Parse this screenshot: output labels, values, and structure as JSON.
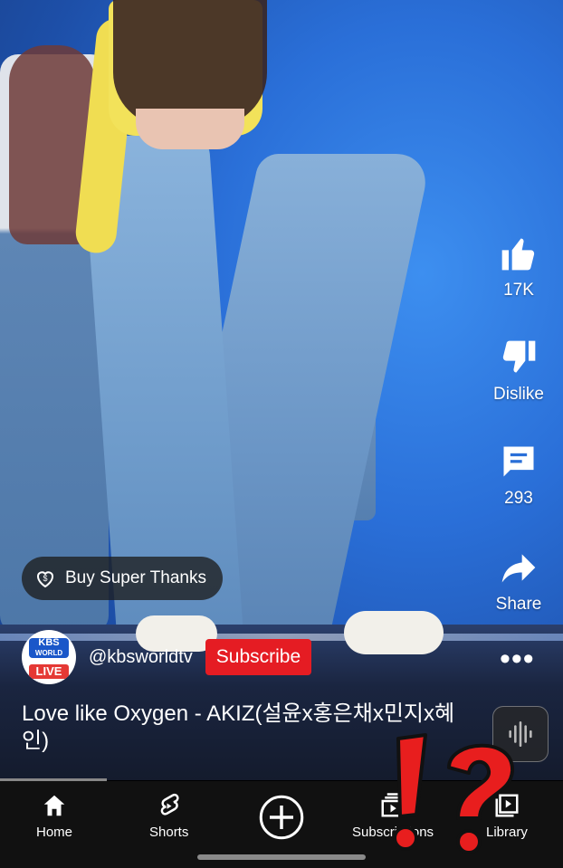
{
  "actions": {
    "like_count": "17K",
    "dislike_label": "Dislike",
    "comment_count": "293",
    "share_label": "Share"
  },
  "super_thanks": {
    "label": "Buy Super Thanks"
  },
  "channel": {
    "handle": "@kbsworldtv",
    "avatar_line1": "KBS",
    "avatar_line2": "WORLD",
    "avatar_badge": "LIVE",
    "subscribe_label": "Subscribe"
  },
  "video": {
    "title": "Love like Oxygen - AKIZ(설윤x홍은채x민지x혜인)",
    "progress": 0.19
  },
  "nav": [
    {
      "label": "Home",
      "icon": "home-icon"
    },
    {
      "label": "Shorts",
      "icon": "shorts-icon"
    },
    {
      "label": "",
      "icon": "create-icon"
    },
    {
      "label": "Subscriptions",
      "icon": "subscriptions-icon"
    },
    {
      "label": "Library",
      "icon": "library-icon"
    }
  ],
  "overlay": {
    "icon": "exclamation-question-icon"
  },
  "colors": {
    "subscribe": "#e51c23",
    "overlay_red": "#e81e1e",
    "stage_blue": "#2a6fd8"
  }
}
